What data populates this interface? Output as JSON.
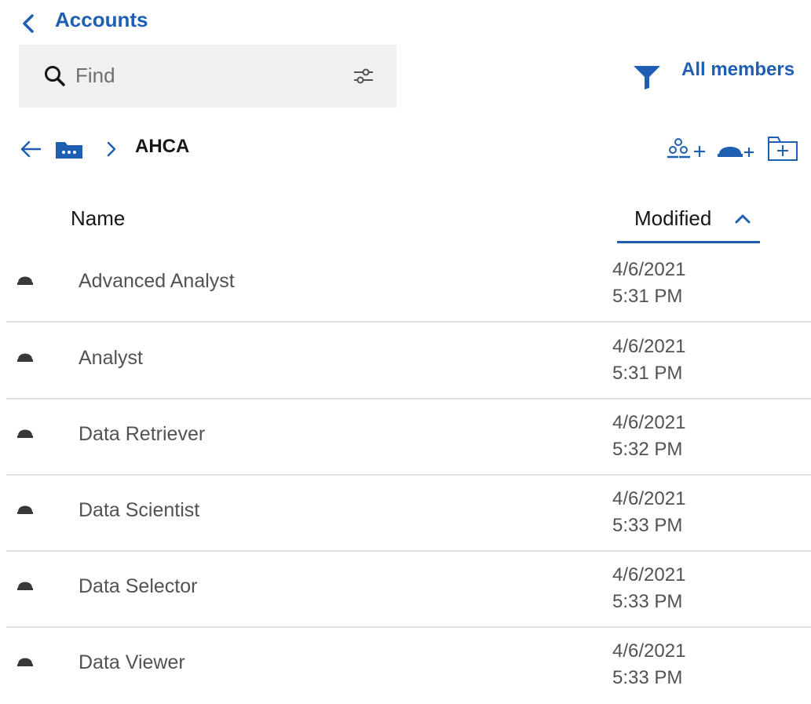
{
  "header": {
    "title": "Accounts"
  },
  "search": {
    "placeholder": "Find"
  },
  "filter": {
    "label": "All members"
  },
  "breadcrumb": {
    "current": "AHCA"
  },
  "table": {
    "columns": {
      "name": "Name",
      "modified": "Modified",
      "sort": "ascending"
    },
    "rows": [
      {
        "icon": "role-icon",
        "name": "Advanced Analyst",
        "date": "4/6/2021",
        "time": "5:31 PM"
      },
      {
        "icon": "role-icon",
        "name": "Analyst",
        "date": "4/6/2021",
        "time": "5:31 PM"
      },
      {
        "icon": "role-icon",
        "name": "Data Retriever",
        "date": "4/6/2021",
        "time": "5:32 PM"
      },
      {
        "icon": "role-icon",
        "name": "Data Scientist",
        "date": "4/6/2021",
        "time": "5:33 PM"
      },
      {
        "icon": "role-icon",
        "name": "Data Selector",
        "date": "4/6/2021",
        "time": "5:33 PM"
      },
      {
        "icon": "role-icon",
        "name": "Data Viewer",
        "date": "4/6/2021",
        "time": "5:33 PM"
      }
    ]
  },
  "colors": {
    "accent": "#1f5fb3",
    "search_bg": "#f0f0f0",
    "row_text": "#525252",
    "divider": "#e0e0e0"
  }
}
